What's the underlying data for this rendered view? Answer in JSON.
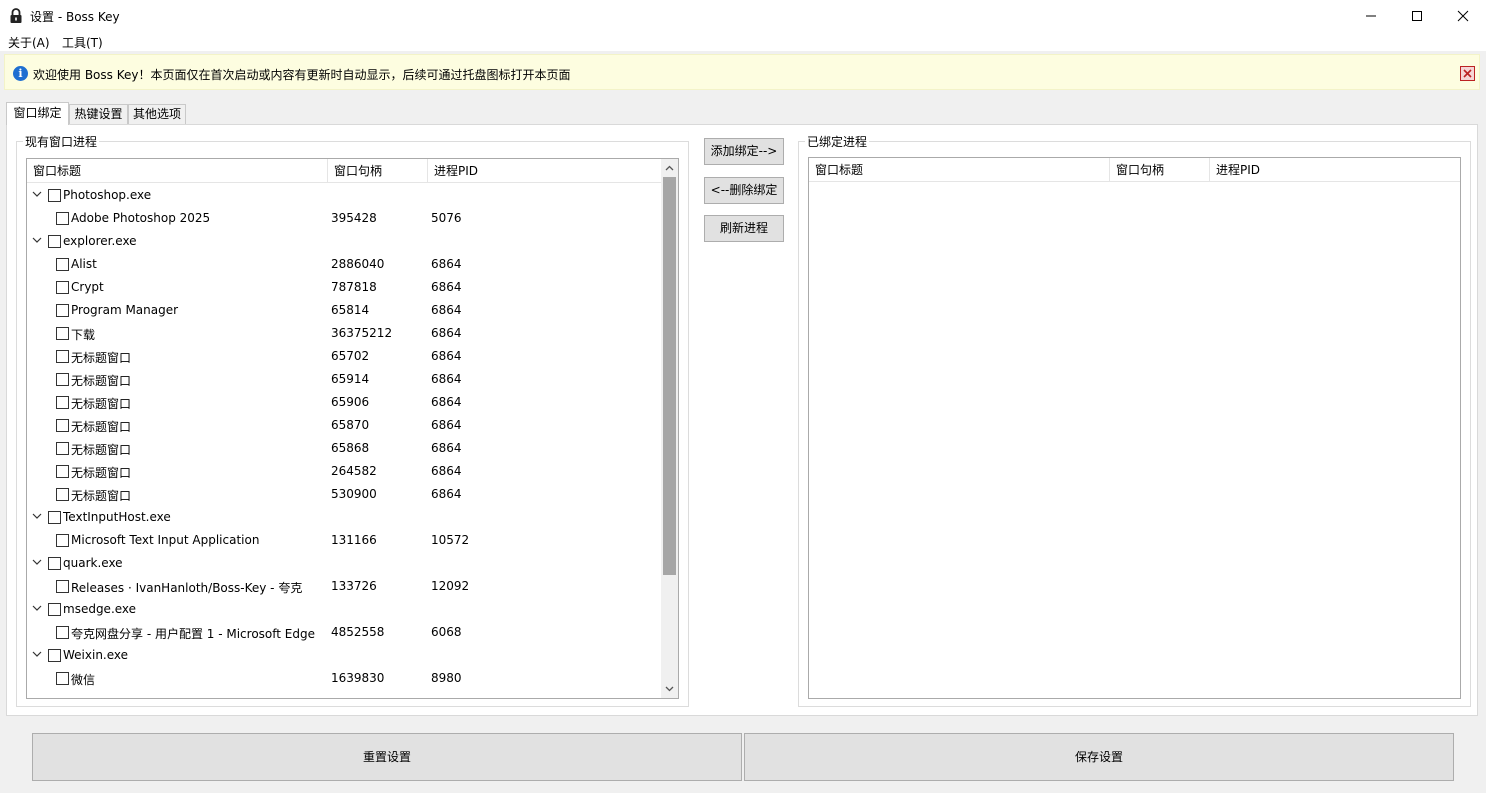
{
  "window": {
    "title": "设置 - Boss Key"
  },
  "menu": {
    "about": "关于(A)",
    "tools": "工具(T)"
  },
  "info": {
    "message": "欢迎使用 Boss Key！本页面仅在首次启动或内容有更新时自动显示，后续可通过托盘图标打开本页面"
  },
  "tabs": [
    "窗口绑定",
    "热键设置",
    "其他选项"
  ],
  "left": {
    "group_title": "现有窗口进程",
    "columns": [
      "窗口标题",
      "窗口句柄",
      "进程PID"
    ],
    "rows": [
      {
        "level": 0,
        "title": "Photoshop.exe",
        "handle": "",
        "pid": ""
      },
      {
        "level": 1,
        "title": "Adobe Photoshop 2025",
        "handle": "395428",
        "pid": "5076"
      },
      {
        "level": 0,
        "title": "explorer.exe",
        "handle": "",
        "pid": ""
      },
      {
        "level": 1,
        "title": "Alist",
        "handle": "2886040",
        "pid": "6864"
      },
      {
        "level": 1,
        "title": "Crypt",
        "handle": "787818",
        "pid": "6864"
      },
      {
        "level": 1,
        "title": "Program Manager",
        "handle": "65814",
        "pid": "6864"
      },
      {
        "level": 1,
        "title": "下载",
        "handle": "36375212",
        "pid": "6864"
      },
      {
        "level": 1,
        "title": "无标题窗口",
        "handle": "65702",
        "pid": "6864"
      },
      {
        "level": 1,
        "title": "无标题窗口",
        "handle": "65914",
        "pid": "6864"
      },
      {
        "level": 1,
        "title": "无标题窗口",
        "handle": "65906",
        "pid": "6864"
      },
      {
        "level": 1,
        "title": "无标题窗口",
        "handle": "65870",
        "pid": "6864"
      },
      {
        "level": 1,
        "title": "无标题窗口",
        "handle": "65868",
        "pid": "6864"
      },
      {
        "level": 1,
        "title": "无标题窗口",
        "handle": "264582",
        "pid": "6864"
      },
      {
        "level": 1,
        "title": "无标题窗口",
        "handle": "530900",
        "pid": "6864"
      },
      {
        "level": 0,
        "title": "TextInputHost.exe",
        "handle": "",
        "pid": ""
      },
      {
        "level": 1,
        "title": "Microsoft Text Input Application",
        "handle": "131166",
        "pid": "10572"
      },
      {
        "level": 0,
        "title": "quark.exe",
        "handle": "",
        "pid": ""
      },
      {
        "level": 1,
        "title": "Releases · IvanHanloth/Boss-Key - 夸克",
        "handle": "133726",
        "pid": "12092"
      },
      {
        "level": 0,
        "title": "msedge.exe",
        "handle": "",
        "pid": ""
      },
      {
        "level": 1,
        "title": "夸克网盘分享 - 用户配置 1 - Microsoft Edge",
        "handle": "4852558",
        "pid": "6068"
      },
      {
        "level": 0,
        "title": "Weixin.exe",
        "handle": "",
        "pid": ""
      },
      {
        "level": 1,
        "title": "微信",
        "handle": "1639830",
        "pid": "8980"
      }
    ]
  },
  "buttons": {
    "add": "添加绑定-->",
    "remove": "<--删除绑定",
    "refresh": "刷新进程",
    "reset": "重置设置",
    "save": "保存设置"
  },
  "right": {
    "group_title": "已绑定进程",
    "columns": [
      "窗口标题",
      "窗口句柄",
      "进程PID"
    ]
  }
}
